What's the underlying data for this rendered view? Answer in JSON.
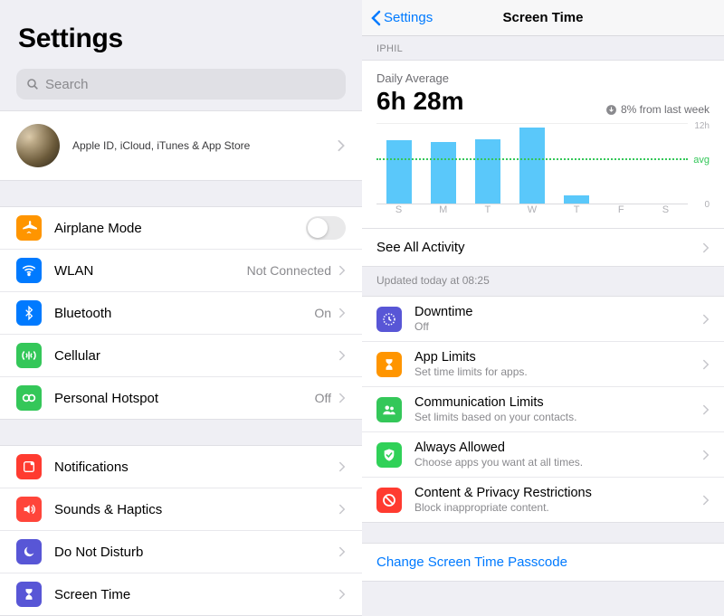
{
  "left": {
    "title": "Settings",
    "search_placeholder": "Search",
    "account_subtitle": "Apple ID, iCloud, iTunes & App Store",
    "rows1": [
      {
        "label": "Airplane Mode",
        "value": "",
        "switch": true
      },
      {
        "label": "WLAN",
        "value": "Not Connected"
      },
      {
        "label": "Bluetooth",
        "value": "On"
      },
      {
        "label": "Cellular",
        "value": ""
      },
      {
        "label": "Personal Hotspot",
        "value": "Off"
      }
    ],
    "rows2": [
      {
        "label": "Notifications"
      },
      {
        "label": "Sounds & Haptics"
      },
      {
        "label": "Do Not Disturb"
      },
      {
        "label": "Screen Time"
      }
    ]
  },
  "right": {
    "back": "Settings",
    "title": "Screen Time",
    "device_header": "IPHIL",
    "daily_label": "Daily Average",
    "daily_value": "6h 28m",
    "delta_text": "8% from last week",
    "avg_label": "avg",
    "ymax": "12h",
    "ymin": "0",
    "see_all": "See All Activity",
    "updated": "Updated today at 08:25",
    "items": [
      {
        "title": "Downtime",
        "sub": "Off"
      },
      {
        "title": "App Limits",
        "sub": "Set time limits for apps."
      },
      {
        "title": "Communication Limits",
        "sub": "Set limits based on your contacts."
      },
      {
        "title": "Always Allowed",
        "sub": "Choose apps you want at all times."
      },
      {
        "title": "Content & Privacy Restrictions",
        "sub": "Block inappropriate content."
      }
    ],
    "change_passcode": "Change Screen Time Passcode"
  },
  "chart_data": {
    "type": "bar",
    "categories": [
      "S",
      "M",
      "T",
      "W",
      "T",
      "F",
      "S"
    ],
    "values": [
      9.5,
      9.2,
      9.6,
      11.4,
      1.3,
      0,
      0
    ],
    "avg": 6.47,
    "title": "Daily Average",
    "xlabel": "",
    "ylabel": "hours",
    "ylim": [
      0,
      12
    ]
  }
}
